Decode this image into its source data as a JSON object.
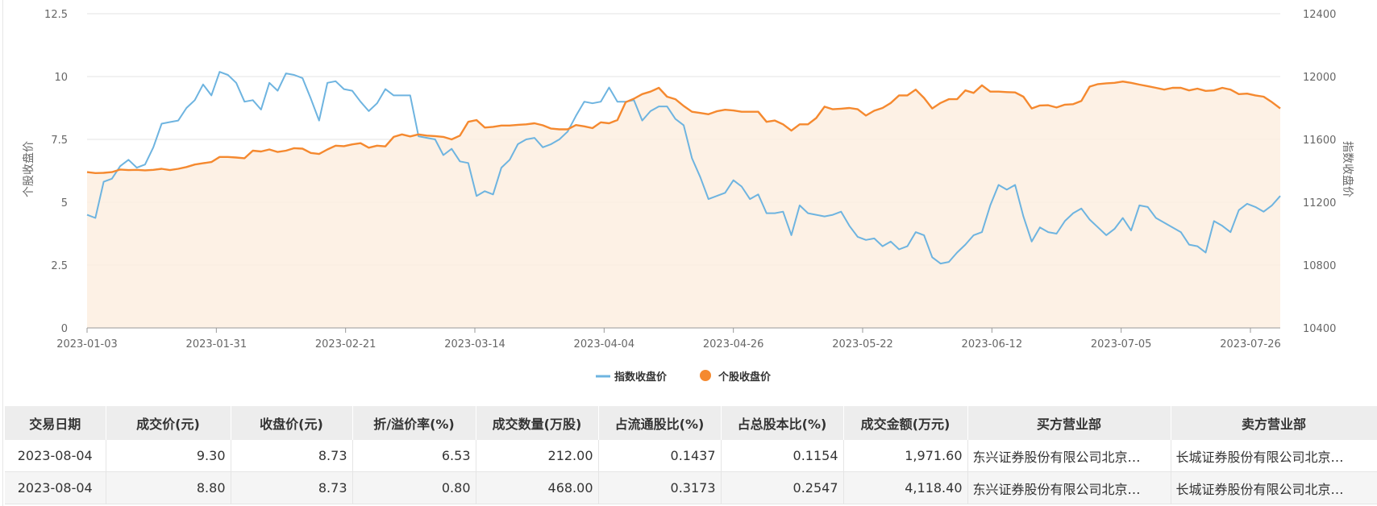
{
  "chart_data": {
    "type": "line",
    "x_ticks": [
      "2023-01-03",
      "2023-01-31",
      "2023-02-21",
      "2023-03-14",
      "2023-04-04",
      "2023-04-26",
      "2023-05-22",
      "2023-06-12",
      "2023-07-05",
      "2023-07-26"
    ],
    "y_left": {
      "label": "个股收盘价",
      "min": 0,
      "max": 12.5,
      "ticks": [
        "0",
        "2.5",
        "5",
        "7.5",
        "10",
        "12.5"
      ]
    },
    "y_right": {
      "label": "指数收盘价",
      "min": 10400,
      "max": 12400,
      "ticks": [
        "10400",
        "10800",
        "11200",
        "11600",
        "12000",
        "12400"
      ]
    },
    "legend": {
      "position": "bottom-center"
    },
    "grid": true,
    "series": [
      {
        "name": "指数收盘价",
        "axis": "right",
        "color": "#6eb4e0",
        "values": [
          11120,
          11100,
          11330,
          11350,
          11430,
          11470,
          11420,
          11440,
          11550,
          11700,
          11710,
          11720,
          11800,
          11850,
          11950,
          11880,
          12030,
          12010,
          11960,
          11840,
          11850,
          11790,
          11960,
          11910,
          12020,
          12010,
          11990,
          11860,
          11720,
          11960,
          11970,
          11920,
          11910,
          11840,
          11780,
          11830,
          11920,
          11880,
          11880,
          11880,
          11620,
          11610,
          11600,
          11500,
          11540,
          11460,
          11450,
          11240,
          11270,
          11250,
          11420,
          11470,
          11570,
          11600,
          11610,
          11550,
          11570,
          11600,
          11650,
          11750,
          11840,
          11830,
          11840,
          11930,
          11840,
          11840,
          11850,
          11720,
          11780,
          11810,
          11810,
          11730,
          11690,
          11480,
          11360,
          11220,
          11240,
          11260,
          11340,
          11300,
          11220,
          11250,
          11130,
          11130,
          11140,
          10990,
          11180,
          11130,
          11120,
          11110,
          11120,
          11140,
          11050,
          10980,
          10960,
          10970,
          10920,
          10950,
          10900,
          10920,
          11010,
          10990,
          10850,
          10810,
          10820,
          10880,
          10930,
          10990,
          11010,
          11180,
          11310,
          11280,
          11310,
          11110,
          10950,
          11040,
          11010,
          11000,
          11080,
          11130,
          11160,
          11090,
          11040,
          10990,
          11030,
          11100,
          11020,
          11180,
          11170,
          11100,
          11070,
          11040,
          11010,
          10930,
          10920,
          10880,
          11080,
          11050,
          11010,
          11150,
          11190,
          11170,
          11140,
          11180,
          11240
        ]
      },
      {
        "name": "个股收盘价",
        "axis": "left",
        "color": "#f5892f",
        "values": [
          6.2,
          6.16,
          6.17,
          6.2,
          6.3,
          6.28,
          6.29,
          6.27,
          6.29,
          6.33,
          6.28,
          6.33,
          6.4,
          6.5,
          6.55,
          6.6,
          6.8,
          6.8,
          6.78,
          6.75,
          7.05,
          7.02,
          7.1,
          7.0,
          7.05,
          7.15,
          7.13,
          6.96,
          6.92,
          7.1,
          7.25,
          7.23,
          7.3,
          7.35,
          7.17,
          7.25,
          7.22,
          7.6,
          7.7,
          7.62,
          7.7,
          7.65,
          7.63,
          7.6,
          7.5,
          7.65,
          8.2,
          8.27,
          7.97,
          8.0,
          8.05,
          8.05,
          8.08,
          8.1,
          8.14,
          8.06,
          7.93,
          7.9,
          7.9,
          8.07,
          8.02,
          7.95,
          8.18,
          8.14,
          8.27,
          8.98,
          9.12,
          9.3,
          9.4,
          9.55,
          9.2,
          9.1,
          8.83,
          8.6,
          8.55,
          8.5,
          8.62,
          8.68,
          8.65,
          8.6,
          8.6,
          8.6,
          8.2,
          8.25,
          8.1,
          7.85,
          8.1,
          8.1,
          8.35,
          8.8,
          8.7,
          8.72,
          8.75,
          8.7,
          8.45,
          8.64,
          8.75,
          8.95,
          9.25,
          9.25,
          9.48,
          9.15,
          8.73,
          8.95,
          9.1,
          9.1,
          9.45,
          9.35,
          9.65,
          9.4,
          9.4,
          9.38,
          9.37,
          9.2,
          8.73,
          8.85,
          8.86,
          8.77,
          8.88,
          8.9,
          9.03,
          9.6,
          9.7,
          9.73,
          9.75,
          9.8,
          9.75,
          9.68,
          9.62,
          9.55,
          9.48,
          9.55,
          9.55,
          9.45,
          9.52,
          9.43,
          9.45,
          9.55,
          9.48,
          9.3,
          9.32,
          9.25,
          9.2,
          8.98,
          8.73
        ]
      }
    ]
  },
  "table": {
    "headers": [
      "交易日期",
      "成交价(元)",
      "收盘价(元)",
      "折/溢价率(%)",
      "成交数量(万股)",
      "占流通股比(%)",
      "占总股本比(%)",
      "成交金额(万元)",
      "买方营业部",
      "卖方营业部"
    ],
    "rows": [
      [
        "2023-08-04",
        "9.30",
        "8.73",
        "6.53",
        "212.00",
        "0.1437",
        "0.1154",
        "1,971.60",
        "东兴证券股份有限公司北京…",
        "长城证券股份有限公司北京…"
      ],
      [
        "2023-08-04",
        "8.80",
        "8.73",
        "0.80",
        "468.00",
        "0.3173",
        "0.2547",
        "4,118.40",
        "东兴证券股份有限公司北京…",
        "长城证券股份有限公司北京…"
      ]
    ]
  }
}
